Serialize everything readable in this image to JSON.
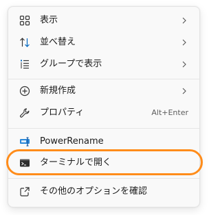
{
  "context_menu": {
    "items": [
      {
        "name": "view",
        "label": "表示",
        "icon": "view-grid-icon",
        "has_submenu": true
      },
      {
        "name": "sort",
        "label": "並べ替え",
        "icon": "sort-icon",
        "has_submenu": true
      },
      {
        "name": "group",
        "label": "グループで表示",
        "icon": "group-list-icon",
        "has_submenu": true
      },
      {
        "name": "new",
        "label": "新規作成",
        "icon": "add-circle-icon",
        "has_submenu": true
      },
      {
        "name": "properties",
        "label": "プロパティ",
        "icon": "wrench-icon",
        "shortcut": "Alt+Enter"
      },
      {
        "name": "powerrename",
        "label": "PowerRename",
        "icon": "powerrename-icon"
      },
      {
        "name": "open-terminal",
        "label": "ターミナルで開く",
        "icon": "terminal-icon",
        "highlighted": true
      },
      {
        "name": "more-options",
        "label": "その他のオプションを確認",
        "icon": "open-external-icon"
      }
    ]
  },
  "colors": {
    "menu_background": "#f9f9f9",
    "highlight_ring": "#ff8c1a",
    "accent_blue": "#0067c0",
    "text": "#1b1b1b"
  }
}
